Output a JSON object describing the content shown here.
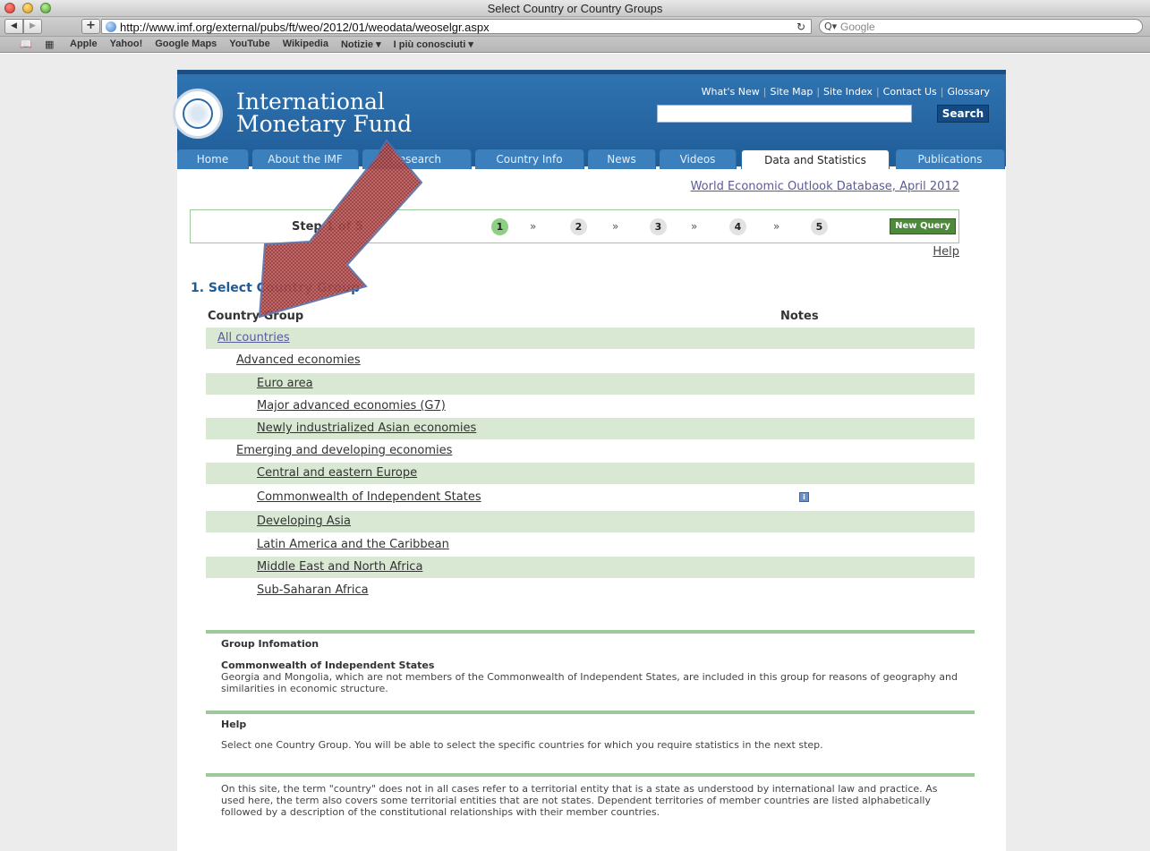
{
  "window": {
    "title": "Select Country or Country Groups"
  },
  "toolbar": {
    "back_icon": "◀",
    "forward_icon": "▶",
    "add_icon": "+",
    "url": "http://www.imf.org/external/pubs/ft/weo/2012/01/weodata/weoselgr.aspx",
    "reload_icon": "↻",
    "search_icon": "Q▾",
    "search_placeholder": "Google"
  },
  "bookmarks": {
    "items": [
      "Apple",
      "Yahoo!",
      "Google Maps",
      "YouTube",
      "Wikipedia",
      "Notizie ▾",
      "I più conosciuti ▾"
    ]
  },
  "header": {
    "brand_line1": "International",
    "brand_line2": "Monetary Fund",
    "top_links": [
      "What's New",
      "Site Map",
      "Site Index",
      "Contact Us",
      "Glossary"
    ],
    "search_button": "Search",
    "tabs": [
      "Home",
      "About the IMF",
      "Research",
      "Country Info",
      "News",
      "Videos",
      "Data and Statistics",
      "Publications"
    ],
    "active_tab": "Data and Statistics"
  },
  "colors": {
    "imf_blue": "#1f5c97",
    "tab_blue": "#3b7fbc",
    "row_green": "#d8e8d3",
    "rule_green": "#9cc89a",
    "button_green": "#4d8a3b",
    "arrow_red": "#b0303a"
  },
  "weo_link": "World Economic Outlook Database, April 2012",
  "steps": {
    "label": "Step 1 of 5",
    "numbers": [
      "1",
      "2",
      "3",
      "4",
      "5"
    ],
    "separator": "»",
    "current": 1,
    "new_query": "New Query",
    "help": "Help"
  },
  "section": {
    "title": "1. Select Country Group",
    "col_group": "Country Group",
    "col_notes": "Notes"
  },
  "groups": [
    {
      "label": "All countries"
    },
    {
      "label": "Advanced economies"
    },
    {
      "label": "Euro area"
    },
    {
      "label": "Major advanced economies (G7)"
    },
    {
      "label": "Newly industrialized Asian economies"
    },
    {
      "label": "Emerging and developing economies"
    },
    {
      "label": "Central and eastern Europe"
    },
    {
      "label": "Commonwealth of Independent States",
      "note_icon": "info-icon"
    },
    {
      "label": "Developing Asia"
    },
    {
      "label": "Latin America and the Caribbean"
    },
    {
      "label": "Middle East and North Africa"
    },
    {
      "label": "Sub-Saharan Africa"
    }
  ],
  "info_glyph": "i",
  "group_info": {
    "title": "Group Infomation",
    "subtitle": "Commonwealth of Independent States",
    "text": "Georgia and Mongolia, which are not members of the Commonwealth of Independent States, are included in this group for reasons of geography and similarities in economic structure."
  },
  "help_panel": {
    "title": "Help",
    "text": "Select one Country Group. You will be able to select the specific countries for which you require statistics in the next step."
  },
  "disclaimer": "On this site, the term \"country\" does not in all cases refer to a territorial entity that is a state as understood by international law and practice. As used here, the term also covers some territorial entities that are not states. Dependent territories of member countries are listed alphabetically followed by a description of the constitutional relationships with their member countries."
}
